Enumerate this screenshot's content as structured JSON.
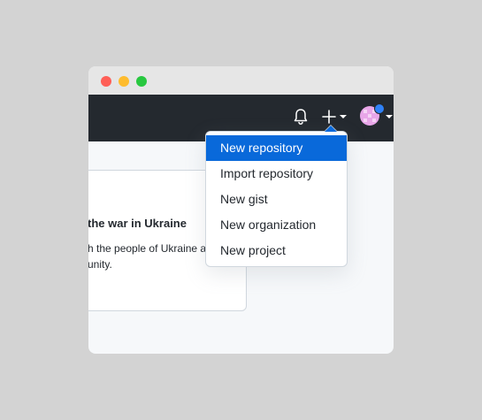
{
  "header": {
    "icons": {
      "notifications": "bell-icon",
      "create": "plus-icon",
      "create_caret": "caret-down-icon",
      "avatar_caret": "caret-down-icon"
    }
  },
  "card": {
    "title": "the war in Ukraine",
    "line1": "h the people of Ukraine a",
    "line2": "unity."
  },
  "create_menu": {
    "items": [
      {
        "label": "New repository",
        "selected": true
      },
      {
        "label": "Import repository",
        "selected": false
      },
      {
        "label": "New gist",
        "selected": false
      },
      {
        "label": "New organization",
        "selected": false
      },
      {
        "label": "New project",
        "selected": false
      }
    ]
  },
  "colors": {
    "header_bg": "#24292f",
    "accent": "#0969da",
    "page_bg": "#f6f8fa",
    "avatar_status": "#2f81f7"
  }
}
